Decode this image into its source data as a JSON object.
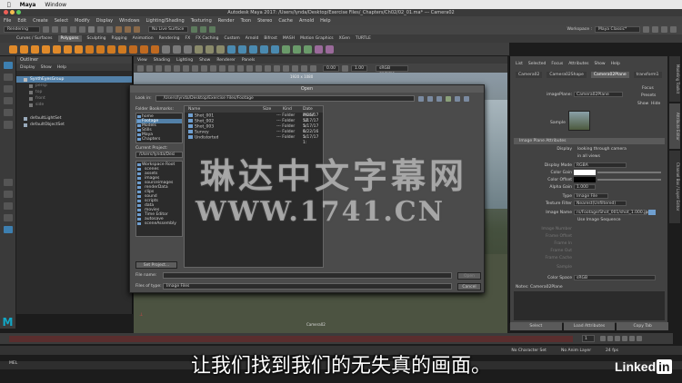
{
  "mac_menu": [
    "Maya",
    "Window"
  ],
  "window_title": "Autodesk Maya 2017: /Users/lynda/Desktop/Exercise Files/_Chapters/Ch02/02_01.ma*  ---  Camera02",
  "maya_menu": [
    "File",
    "Edit",
    "Create",
    "Select",
    "Modify",
    "Display",
    "Windows",
    "Lighting/Shading",
    "Texturing",
    "Render",
    "Toon",
    "Stereo",
    "Cache",
    "Arnold",
    "Help"
  ],
  "status_line": {
    "menu_set": "Rendering",
    "live_surface": "No Live Surface",
    "workspace_label": "Workspace :",
    "workspace_value": "Maya Classic*"
  },
  "shelf_tabs": [
    "Curves / Surfaces",
    "Polygons",
    "Sculpting",
    "Rigging",
    "Animation",
    "Rendering",
    "FX",
    "FX Caching",
    "Custom",
    "Arnold",
    "Bifrost",
    "MASH",
    "Motion Graphics",
    "XGen",
    "TURTLE"
  ],
  "shelf_active": "Polygons",
  "outliner": {
    "title": "Outliner",
    "menu": [
      "Display",
      "Show",
      "Help"
    ],
    "items": [
      {
        "label": "SynthEyesGroup",
        "selected": true
      },
      {
        "label": "persp",
        "selected": false
      },
      {
        "label": "top",
        "selected": false
      },
      {
        "label": "front",
        "selected": false
      },
      {
        "label": "side",
        "selected": false
      },
      {
        "label": "defaultLightSet",
        "selected": false
      },
      {
        "label": "defaultObjectSet",
        "selected": false
      }
    ]
  },
  "viewport": {
    "menu": [
      "View",
      "Shading",
      "Lighting",
      "Show",
      "Renderer",
      "Panels"
    ],
    "field1": "0.00",
    "field2": "1.00",
    "colorspace": "sRGB gamma",
    "resolution": "1920 x 1080",
    "camera_label": "Camera02"
  },
  "dialog": {
    "title": "Open",
    "look_in_label": "Look in:",
    "look_in_path": "/Users/lynda/Desktop/Exercise Files/Footage",
    "bookmarks_label": "Folder Bookmarks:",
    "bookmarks": [
      "home",
      "Footage",
      "Models",
      "Stills",
      "Maya",
      "Chapters"
    ],
    "current_project_label": "Current Project:",
    "current_project": "/Users/lynda/Desi",
    "project_tree": [
      "Workspace Root",
      "scenes",
      "assets",
      "images",
      "sourceimages",
      "renderData",
      "clips",
      "sound",
      "scripts",
      "data",
      "movies",
      "Time Editor",
      "autosave",
      "sceneAssembly"
    ],
    "set_project": "Set Project...",
    "columns": [
      "Name",
      "Size",
      "Kind",
      "Date Modif"
    ],
    "files": [
      {
        "name": "Shot_001",
        "size": "",
        "kind": "--- Folder",
        "date": "4/25/17 12"
      },
      {
        "name": "Shot_002",
        "size": "",
        "kind": "--- Folder",
        "date": "5/17/17 1:"
      },
      {
        "name": "Shot_003",
        "size": "",
        "kind": "--- Folder",
        "date": "5/17/17 1:"
      },
      {
        "name": "Survey",
        "size": "",
        "kind": "--- Folder",
        "date": "6/22/16 1:"
      },
      {
        "name": "Undistorted",
        "size": "",
        "kind": "--- Folder",
        "date": "5/17/17 1:"
      }
    ],
    "file_name_label": "File name:",
    "file_name_value": "",
    "file_type_label": "Files of type:",
    "file_type_value": "Image Files",
    "open_button": "Open",
    "cancel_button": "Cancel"
  },
  "attribute_editor": {
    "menu": [
      "List",
      "Selected",
      "Focus",
      "Attributes",
      "Show",
      "Help"
    ],
    "tabs": [
      "Camera02",
      "Camera02Shape",
      "Camera02Plane",
      "transform1"
    ],
    "active_tab": "Camera02Plane",
    "imageplane_label": "imagePlane:",
    "imageplane_value": "Camera02Plane",
    "focus_button": "Focus",
    "presets_button": "Presets",
    "show_button": "Show",
    "hide_button": "Hide",
    "sample_label": "Sample",
    "section_title": "Image Plane Attributes",
    "display_label": "Display",
    "display_value": "looking through camera",
    "all_views": "in all views",
    "display_mode_label": "Display Mode",
    "display_mode_value": "RGBA",
    "color_gain_label": "Color Gain",
    "color_offset_label": "Color Offset",
    "alpha_gain_label": "Alpha Gain",
    "alpha_gain_value": "1.000",
    "type_label": "Type",
    "type_value": "Image File",
    "texture_filter_label": "Texture Filter",
    "texture_filter_value": "Nearest(Unfiltered)",
    "image_name_label": "Image Name",
    "image_name_value": "rs/Footage/Shot_001/shot_1.000.jpg",
    "use_sequence": "Use Image Sequence",
    "image_number_label": "Image Number",
    "frame_offset_label": "Frame Offset",
    "frame_in_label": "Frame In",
    "frame_out_label": "Frame Out",
    "frame_cache_label": "Frame Cache",
    "sample_row_label": "Sample",
    "color_space_label": "Color Space",
    "color_space_value": "sRGB",
    "notes_label": "Notes: Camera02Plane",
    "buttons": [
      "Select",
      "Load Attributes",
      "Copy Tab"
    ]
  },
  "side_tabs": [
    "Modeling Toolkit",
    "Attribute Editor",
    "Channel Box / Layer Editor"
  ],
  "time": {
    "current_frame": "1",
    "fps": "24 fps",
    "character_set": "No Character Set",
    "anim_layer": "No Anim Layer"
  },
  "command_line_label": "MEL",
  "watermark_line1": "琳达中文字幕网",
  "watermark_line2": "WWW.1741.CN",
  "subtitle": "让我们找到我们的无失真的画面。",
  "linkedin_text": "Linked",
  "linkedin_in": "in",
  "colors": {
    "selection": "#5280a8",
    "timebar": "#5a2e2e",
    "accent_maya": "#12a7c6"
  }
}
